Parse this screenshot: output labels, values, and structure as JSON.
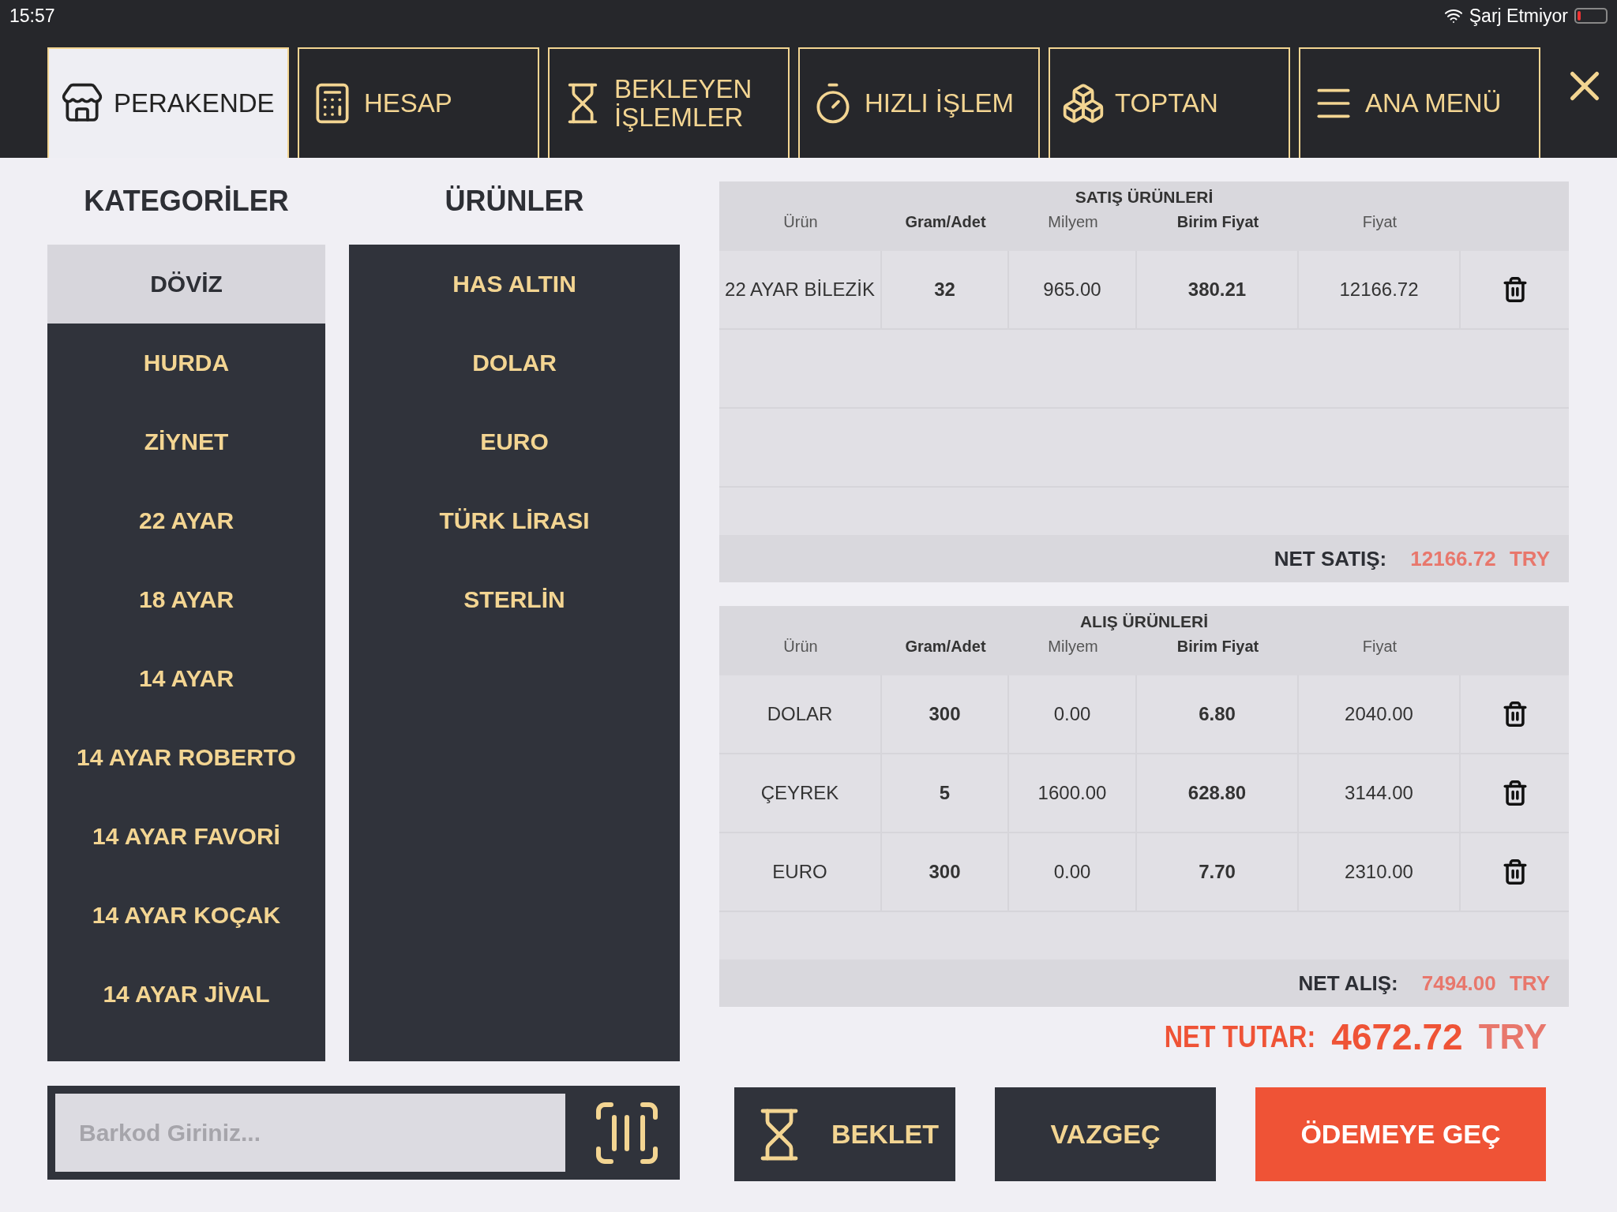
{
  "status_bar": {
    "time": "15:57",
    "battery_text": "Şarj Etmiyor"
  },
  "tabs": [
    {
      "label": "PERAKENDE",
      "selected": true
    },
    {
      "label": "HESAP",
      "selected": false
    },
    {
      "label": "BEKLEYEN İŞLEMLER",
      "selected": false
    },
    {
      "label": "HIZLI İŞLEM",
      "selected": false
    },
    {
      "label": "TOPTAN",
      "selected": false
    },
    {
      "label": "ANA MENÜ",
      "selected": false
    }
  ],
  "categories": {
    "title": "KATEGORİLER",
    "items": [
      {
        "label": "DÖVİZ",
        "selected": true
      },
      {
        "label": "HURDA",
        "selected": false
      },
      {
        "label": "ZİYNET",
        "selected": false
      },
      {
        "label": "22 AYAR",
        "selected": false
      },
      {
        "label": "18 AYAR",
        "selected": false
      },
      {
        "label": "14 AYAR",
        "selected": false
      },
      {
        "label": "14 AYAR ROBERTO",
        "selected": false
      },
      {
        "label": "14 AYAR FAVORİ",
        "selected": false
      },
      {
        "label": "14 AYAR KOÇAK",
        "selected": false
      },
      {
        "label": "14 AYAR JİVAL",
        "selected": false
      }
    ]
  },
  "products": {
    "title": "ÜRÜNLER",
    "items": [
      {
        "label": "HAS ALTIN"
      },
      {
        "label": "DOLAR"
      },
      {
        "label": "EURO"
      },
      {
        "label": "TÜRK LİRASI"
      },
      {
        "label": "STERLİN"
      }
    ]
  },
  "sales": {
    "title": "SATIŞ ÜRÜNLERİ",
    "columns": [
      {
        "label": "Ürün",
        "bold": false
      },
      {
        "label": "Gram/Adet",
        "bold": true
      },
      {
        "label": "Milyem",
        "bold": false
      },
      {
        "label": "Birim Fiyat",
        "bold": true
      },
      {
        "label": "Fiyat",
        "bold": false
      }
    ],
    "rows": [
      [
        "22 AYAR BİLEZİK",
        "32",
        "965.00",
        "380.21",
        "12166.72"
      ]
    ],
    "total_label": "NET SATIŞ:",
    "total_value": "12166.72",
    "currency": "TRY"
  },
  "purchases": {
    "title": "ALIŞ ÜRÜNLERİ",
    "columns": [
      {
        "label": "Ürün",
        "bold": false
      },
      {
        "label": "Gram/Adet",
        "bold": true
      },
      {
        "label": "Milyem",
        "bold": false
      },
      {
        "label": "Birim Fiyat",
        "bold": true
      },
      {
        "label": "Fiyat",
        "bold": false
      }
    ],
    "rows": [
      [
        "DOLAR",
        "300",
        "0.00",
        "6.80",
        "2040.00"
      ],
      [
        "ÇEYREK",
        "5",
        "1600.00",
        "628.80",
        "3144.00"
      ],
      [
        "EURO",
        "300",
        "0.00",
        "7.70",
        "2310.00"
      ]
    ],
    "total_label": "NET ALIŞ:",
    "total_value": "7494.00",
    "currency": "TRY"
  },
  "net": {
    "label": "NET TUTAR:",
    "value": "4672.72",
    "currency": "TRY"
  },
  "barcode": {
    "placeholder": "Barkod Giriniz..."
  },
  "actions": [
    {
      "label": "BEKLET",
      "kind": "hold"
    },
    {
      "label": "VAZGEÇ",
      "kind": "cancel"
    },
    {
      "label": "ÖDEMEYE GEÇ",
      "kind": "primary"
    }
  ]
}
